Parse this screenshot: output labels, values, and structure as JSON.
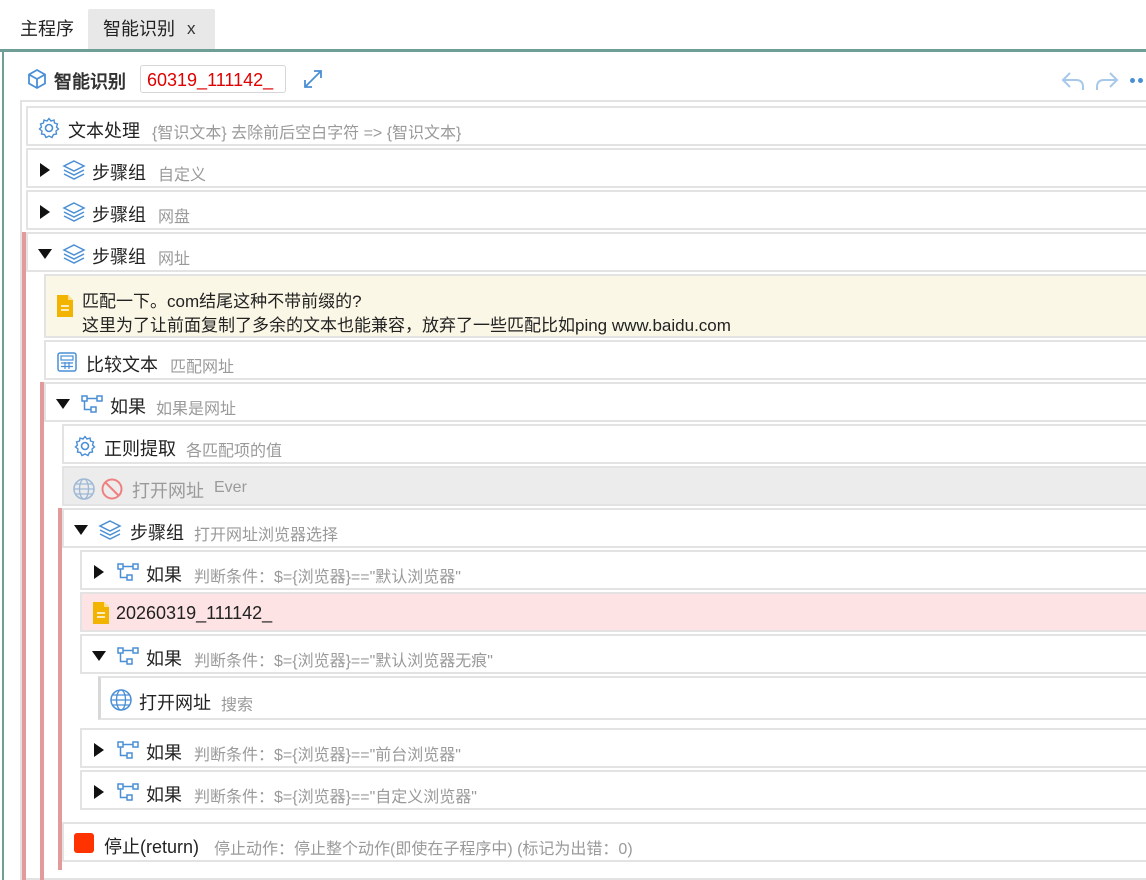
{
  "tabs": [
    {
      "label": "主程序"
    },
    {
      "label": "智能识别",
      "close": "x"
    }
  ],
  "header": {
    "title": "智能识别",
    "input_value": "60319_111142_"
  },
  "steps": {
    "text_process": {
      "label": "文本处理",
      "desc": "{智识文本} 去除前后空白字符 => {智识文本}"
    },
    "group_custom": {
      "label": "步骤组",
      "desc": "自定义"
    },
    "group_disk": {
      "label": "步骤组",
      "desc": "网盘"
    },
    "group_url": {
      "label": "步骤组",
      "desc": "网址"
    },
    "note": {
      "line1": "匹配一下。com结尾这种不带前缀的?",
      "line2": "这里为了让前面复制了多余的文本也能兼容，放弃了一些匹配比如ping www.baidu.com"
    },
    "compare_text": {
      "label": "比较文本",
      "desc": "匹配网址"
    },
    "if_url": {
      "label": "如果",
      "desc": "如果是网址"
    },
    "regex": {
      "label": "正则提取",
      "desc": "各匹配项的值"
    },
    "open_url_ever": {
      "label": "打开网址",
      "desc": "Ever"
    },
    "group_browser": {
      "label": "步骤组",
      "desc": "打开网址浏览器选择"
    },
    "if_default": {
      "label": "如果",
      "desc": "判断条件：$={浏览器}==\"默认浏览器\""
    },
    "pink_note": {
      "label": "20260319_111142_"
    },
    "if_incognito": {
      "label": "如果",
      "desc": "判断条件：$={浏览器}==\"默认浏览器无痕\""
    },
    "open_url_search": {
      "label": "打开网址",
      "desc": "搜索"
    },
    "if_foreground": {
      "label": "如果",
      "desc": "判断条件：$={浏览器}==\"前台浏览器\""
    },
    "if_custom_browser": {
      "label": "如果",
      "desc": "判断条件：$={浏览器}==\"自定义浏览器\""
    },
    "stop": {
      "label": "停止(return)",
      "desc": "停止动作：停止整个动作(即使在子程序中) (标记为出错：0)"
    }
  },
  "colors": {
    "accent": "#4a8fd6",
    "tab_underline": "#6f9e97",
    "error_input": "#e00000",
    "group_bar": "#e39a9a",
    "stop": "#ff3300",
    "note_bg": "#fbf7e6",
    "pink_bg": "#fde3e3"
  },
  "icons": {
    "header": "cube-icon",
    "text_process": "gear-icon",
    "group": "layers-icon",
    "note": "document-icon",
    "compare": "calculator-icon",
    "if": "branch-icon",
    "regex": "gear-icon",
    "url": "globe-icon",
    "disabled": "forbidden-icon",
    "stop": "stop-icon",
    "undo": "undo-icon",
    "redo": "redo-icon",
    "more": "more-icon",
    "expand": "expand-icon"
  }
}
